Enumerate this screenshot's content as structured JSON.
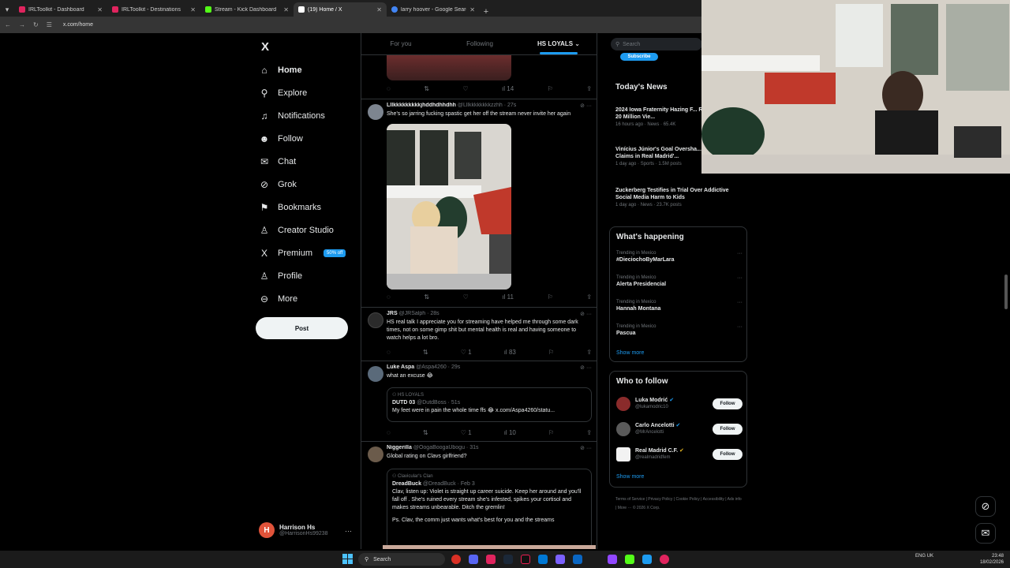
{
  "browser": {
    "tabs": [
      {
        "title": "IRLToolkit - Dashboard",
        "color": "#e0245e"
      },
      {
        "title": "IRLToolkit - Destinations",
        "color": "#e0245e"
      },
      {
        "title": "Stream - Kick Dashboard",
        "color": "#53fc18"
      },
      {
        "title": "(19) Home / X",
        "color": "#ffffff"
      },
      {
        "title": "larry hoover - Google Search",
        "color": "#4285f4"
      }
    ],
    "url": "x.com/home"
  },
  "nav": {
    "logo": "X",
    "items": [
      {
        "label": "Home",
        "icon": "home-icon",
        "glyph": "⌂"
      },
      {
        "label": "Explore",
        "icon": "search-icon",
        "glyph": "⚲"
      },
      {
        "label": "Notifications",
        "icon": "bell-icon",
        "glyph": "♫"
      },
      {
        "label": "Follow",
        "icon": "person-plus-icon",
        "glyph": "☻"
      },
      {
        "label": "Chat",
        "icon": "envelope-icon",
        "glyph": "✉"
      },
      {
        "label": "Grok",
        "icon": "grok-icon",
        "glyph": "⊘"
      },
      {
        "label": "Bookmarks",
        "icon": "bookmark-icon",
        "glyph": "⚑"
      },
      {
        "label": "Creator Studio",
        "icon": "creator-icon",
        "glyph": "♙"
      },
      {
        "label": "Premium",
        "icon": "x-premium-icon",
        "glyph": "X"
      },
      {
        "label": "Profile",
        "icon": "person-icon",
        "glyph": "♙"
      },
      {
        "label": "More",
        "icon": "more-circle-icon",
        "glyph": "⊖"
      }
    ],
    "premium_badge": "50% off",
    "post_label": "Post",
    "account": {
      "initial": "H",
      "name": "Harrison Hs",
      "handle": "@HarrisonHs99238",
      "more": "···"
    }
  },
  "timeline": {
    "tabs": [
      "For you",
      "Following",
      "HS LOYALS ⌄"
    ],
    "tweets": [
      {
        "name": "Lllkkkkkkkkkjhddhdhhdhh",
        "handle": "@Lllkkkkkkkkzzhh",
        "time": "27s",
        "text": "She's so jarring fucking spastic get her off the stream never invite her again",
        "views": "11",
        "avatar_color": "#7d8590"
      },
      {
        "name": "JRS",
        "handle": "@JRSalph",
        "time": "28s",
        "text": "HS real talk I appreciate you for streaming have helped me through some dark times, not on some gimp shit but mental health is real and having someone to watch helps a lot bro.",
        "likes": "1",
        "views": "83",
        "avatar_color": "#2b2b2b"
      },
      {
        "name": "Luke Aspa",
        "handle": "@Aspa4260",
        "time": "29s",
        "text": "what an excuse 😂",
        "likes": "1",
        "views": "10",
        "avatar_color": "#5a6a7a",
        "quote": {
          "community": "HS LOYALS",
          "name": "DUTD 03",
          "handle": "@DutdBoss",
          "time": "51s",
          "text": "My feet were in pain the whole time ffs 😂 x.com/Aspa4260/statu..."
        }
      },
      {
        "name": "Niggerilla",
        "handle": "@OogaBoogaUbogu",
        "time": "31s",
        "text": "Global rating on Clavs girlfriend?",
        "avatar_color": "#6b5b4b",
        "quote": {
          "community": "Clavicular's Clan",
          "name": "DreadBuck",
          "handle": "@DreadBuck",
          "time": "Feb 3",
          "text": "Clav, listen up: Violet is straight up career suicide. Keep her around and you'll fall off . She's ruined every stream she's infested, spikes your cortisol and makes streams unbearable. Ditch the gremlin!",
          "text2": "Ps. Clav, the comm just wants what's best for you and the streams"
        }
      }
    ],
    "top_views": "14"
  },
  "right": {
    "search_placeholder": "Search",
    "subscribe_label": "Subscribe",
    "news_title": "Today's News",
    "news": [
      {
        "title": "2024 Iowa Fraternity Hazing F... Resurfaces with 20 Million Vie...",
        "meta": "16 hours ago · News · 65.4K"
      },
      {
        "title": "Vinícius Júnior's Goal Oversha... Racism Claims in Real Madrid'...",
        "meta": "1 day ago · Sports · 1.5M posts"
      },
      {
        "title": "Zuckerberg Testifies in Trial Over Addictive Social Media Harm to Kids",
        "meta": "1 day ago · News · 23.7K posts"
      }
    ],
    "happening_title": "What's happening",
    "trends": [
      {
        "context": "Trending in Mexico",
        "name": "#DieciochoByMarLara"
      },
      {
        "context": "Trending in Mexico",
        "name": "Alerta Presidencial"
      },
      {
        "context": "Trending in Mexico",
        "name": "Hannah Montana"
      },
      {
        "context": "Trending in Mexico",
        "name": "Pascua"
      }
    ],
    "show_more": "Show more",
    "who_title": "Who to follow",
    "who": [
      {
        "name": "Luka Modrić",
        "handle": "@lukamodric10",
        "color": "#8a2b2b"
      },
      {
        "name": "Carlo Ancelotti",
        "handle": "@MrAncelotti",
        "color": "#5a5a5a"
      },
      {
        "name": "Real Madrid C.F.",
        "handle": "@realmadridfem",
        "color": "#f2f2f2"
      }
    ],
    "follow_label": "Follow",
    "footer": "Terms of Service | Privacy Policy | Cookie Policy | Accessibility | Ads info | More ··· © 2026 X Corp."
  },
  "taskbar": {
    "search": "Search",
    "lang": "ENG\nUK",
    "time": "23:48",
    "date": "18/02/2026"
  }
}
